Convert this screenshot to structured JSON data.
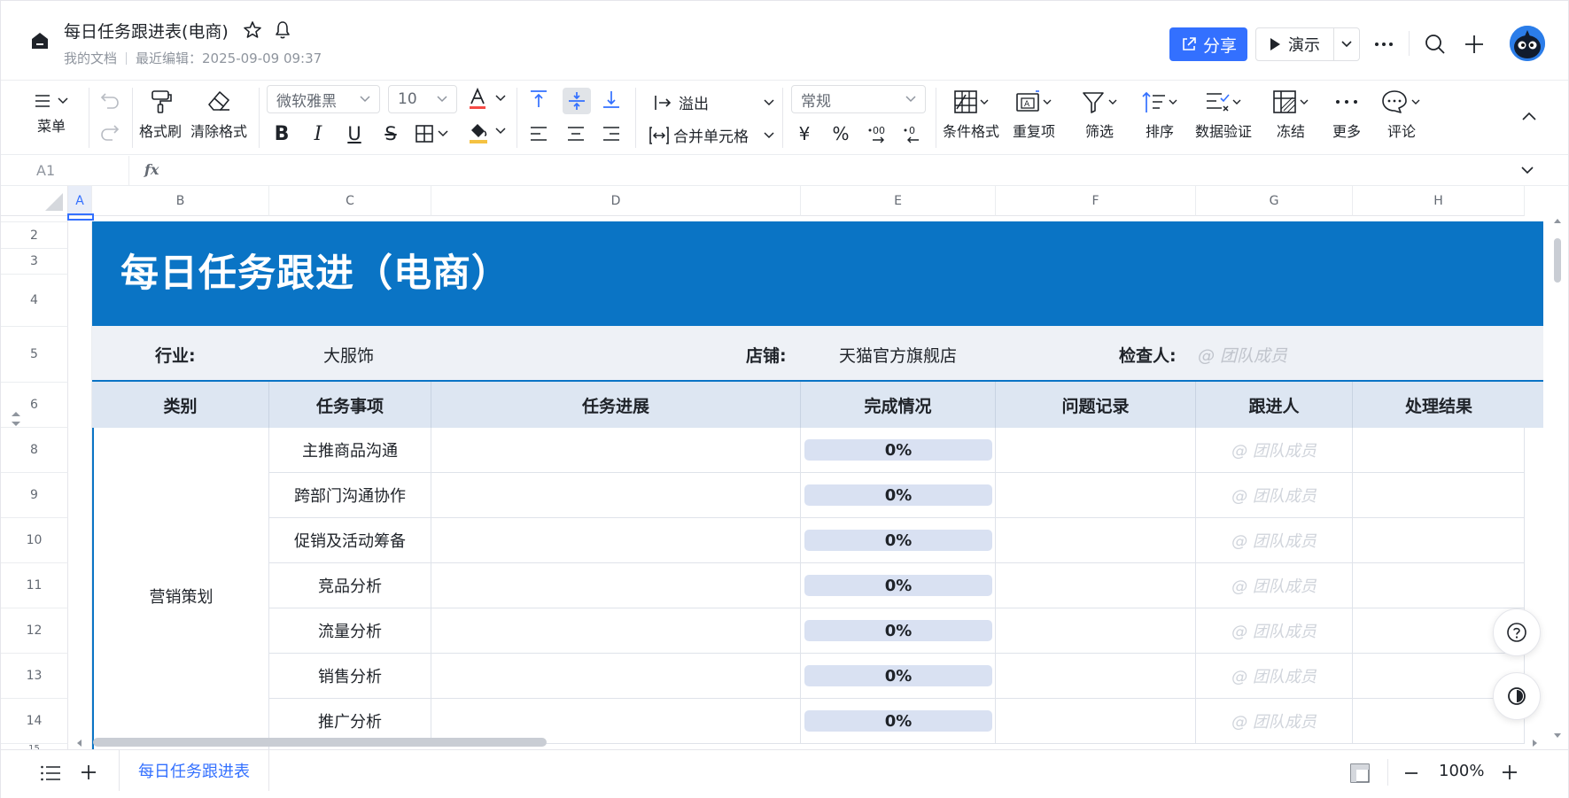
{
  "header": {
    "title": "每日任务跟进表(电商)",
    "location": "我的文档",
    "last_edited": "最近编辑：2025-09-09 09:37",
    "share_label": "分享",
    "present_label": "演示"
  },
  "toolbar": {
    "menu_label": "菜单",
    "format_painter_label": "格式刷",
    "clear_format_label": "清除格式",
    "font_name": "微软雅黑",
    "font_size": "10",
    "overflow_label": "溢出",
    "merge_label": "合并单元格",
    "number_format": "常规",
    "currency_symbol": "¥",
    "percent_symbol": "%",
    "cond_format_label": "条件格式",
    "duplicate_label": "重复项",
    "filter_label": "筛选",
    "sort_label": "排序",
    "validation_label": "数据验证",
    "freeze_label": "冻结",
    "more_label": "更多",
    "comment_label": "评论"
  },
  "formula_bar": {
    "cell_ref": "A1",
    "fx": "fx"
  },
  "columns": [
    "A",
    "B",
    "C",
    "D",
    "E",
    "F",
    "G",
    "H"
  ],
  "rows": [
    "2",
    "3",
    "4",
    "5",
    "6",
    "8",
    "9",
    "10",
    "11",
    "12",
    "13",
    "14",
    "15"
  ],
  "sheet": {
    "title": "每日任务跟进（电商）",
    "info": {
      "industry_label": "行业:",
      "industry_value": "大服饰",
      "store_label": "店铺:",
      "store_value": "天猫官方旗舰店",
      "inspector_label": "检查人:",
      "inspector_value": "@ 团队成员"
    },
    "headers": [
      "类别",
      "任务事项",
      "任务进展",
      "完成情况",
      "问题记录",
      "跟进人",
      "处理结果"
    ],
    "category": "营销策划",
    "tasks": [
      {
        "name": "主推商品沟通",
        "progress": "0%",
        "assignee": "@ 团队成员"
      },
      {
        "name": "跨部门沟通协作",
        "progress": "0%",
        "assignee": "@ 团队成员"
      },
      {
        "name": "促销及活动筹备",
        "progress": "0%",
        "assignee": "@ 团队成员"
      },
      {
        "name": "竞品分析",
        "progress": "0%",
        "assignee": "@ 团队成员"
      },
      {
        "name": "流量分析",
        "progress": "0%",
        "assignee": "@ 团队成员"
      },
      {
        "name": "销售分析",
        "progress": "0%",
        "assignee": "@ 团队成员"
      },
      {
        "name": "推广分析",
        "progress": "0%",
        "assignee": "@ 团队成员"
      }
    ]
  },
  "bottom_bar": {
    "sheet_tab": "每日任务跟进表",
    "zoom": "100%"
  },
  "colors": {
    "accent": "#3370ff",
    "title_band": "#0a74c5",
    "header_fill": "#dde6f2",
    "progress_fill": "#d9e1f2"
  }
}
